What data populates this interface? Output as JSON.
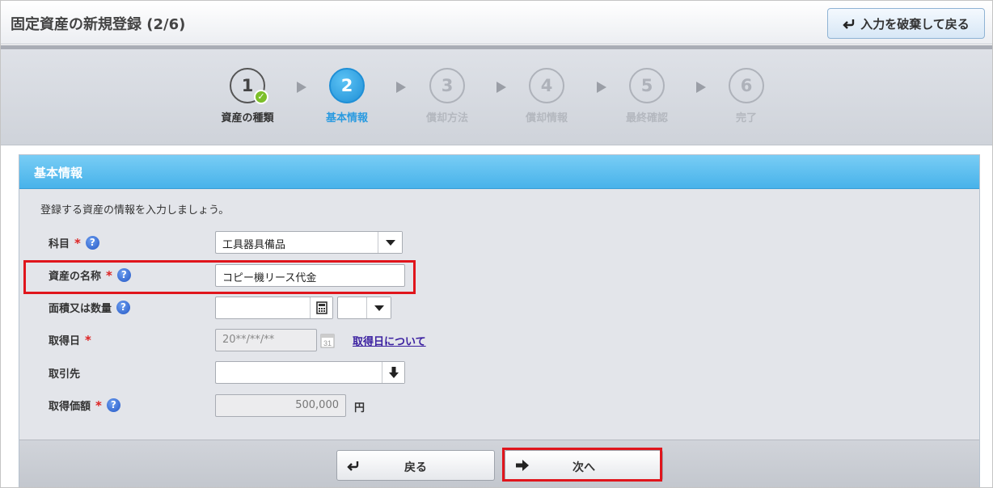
{
  "header": {
    "title": "固定資産の新規登録 (2/6)",
    "discard_label": "入力を破棄して戻る"
  },
  "steps": [
    {
      "num": "1",
      "label": "資産の種類",
      "state": "done"
    },
    {
      "num": "2",
      "label": "基本情報",
      "state": "active"
    },
    {
      "num": "3",
      "label": "償却方法",
      "state": "pending"
    },
    {
      "num": "4",
      "label": "償却情報",
      "state": "pending"
    },
    {
      "num": "5",
      "label": "最終確認",
      "state": "pending"
    },
    {
      "num": "6",
      "label": "完了",
      "state": "pending"
    }
  ],
  "panel": {
    "title": "基本情報",
    "intro": "登録する資産の情報を入力しましょう。",
    "fields": {
      "account": {
        "label": "科目",
        "value": "工具器具備品"
      },
      "asset_name": {
        "label": "資産の名称",
        "value": "コピー機リース代金"
      },
      "quantity": {
        "label": "面積又は数量",
        "value": "",
        "unit_value": ""
      },
      "acq_date": {
        "label": "取得日",
        "placeholder": "20**/**/**",
        "link": "取得日について"
      },
      "partner": {
        "label": "取引先",
        "value": ""
      },
      "acq_price": {
        "label": "取得価額",
        "value": "500,000",
        "unit": "円"
      }
    },
    "required_mark": "*",
    "help_mark": "?"
  },
  "footer": {
    "back_label": "戻る",
    "next_label": "次へ"
  },
  "colors": {
    "accent": "#47b2ea",
    "highlight": "#e0151c",
    "required": "#dd2222"
  }
}
